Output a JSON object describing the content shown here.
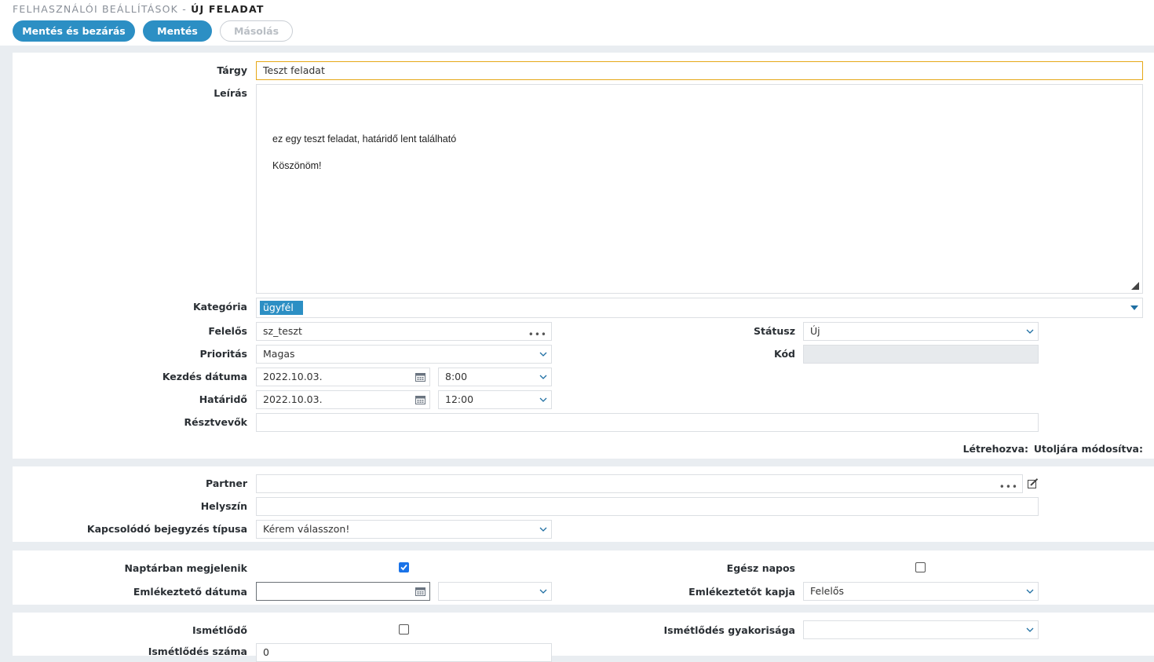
{
  "header": {
    "breadcrumb_parent": "FELHASZNÁLÓI BEÁLLÍTÁSOK - ",
    "breadcrumb_current": "ÚJ FELADAT"
  },
  "toolbar": {
    "save_close_label": "Mentés és bezárás",
    "save_label": "Mentés",
    "copy_label": "Másolás"
  },
  "form": {
    "subject_label": "Tárgy",
    "subject_value": "Teszt feladat",
    "description_label": "Leírás",
    "description_line1": "ez egy teszt feladat, határidő lent található",
    "description_line2": "Köszönöm!",
    "category_label": "Kategória",
    "category_tag": "ügyfél",
    "owner_label": "Felelős",
    "owner_value": "sz_teszt",
    "status_label": "Státusz",
    "status_value": "Új",
    "priority_label": "Prioritás",
    "priority_value": "Magas",
    "code_label": "Kód",
    "start_label": "Kezdés dátuma",
    "start_date": "2022.10.03.",
    "start_time": "8:00",
    "deadline_label": "Határidő",
    "deadline_date": "2022.10.03.",
    "deadline_time": "12:00",
    "participants_label": "Résztvevők",
    "created_label": "Létrehozva:",
    "modified_label": "Utoljára módosítva:"
  },
  "partner_section": {
    "partner_label": "Partner",
    "location_label": "Helyszín",
    "related_type_label": "Kapcsolódó bejegyzés típusa",
    "related_type_value": "Kérem válasszon!"
  },
  "calendar_section": {
    "show_in_calendar_label": "Naptárban megjelenik",
    "show_in_calendar_checked": true,
    "all_day_label": "Egész napos",
    "all_day_checked": false,
    "reminder_date_label": "Emlékeztető dátuma",
    "reminder_recipient_label": "Emlékeztetőt kapja",
    "reminder_recipient_value": "Felelős"
  },
  "recurrence_section": {
    "recurring_label": "Ismétlődő",
    "recurring_checked": false,
    "frequency_label": "Ismétlődés gyakorisága",
    "count_label": "Ismétlődés száma",
    "count_value": "0"
  },
  "colors": {
    "accent": "#2c8fc4",
    "focus_border": "#e6a817",
    "checkbox_on": "#1a73e8"
  }
}
